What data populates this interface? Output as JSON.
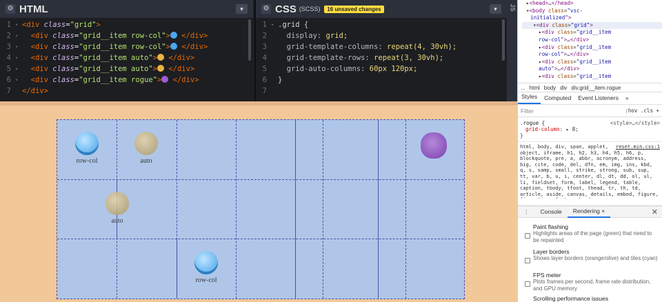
{
  "html_pane": {
    "title": "HTML",
    "lines": [
      {
        "num": "1",
        "fold": "▾",
        "parts": [
          {
            "c": "pl",
            "t": ""
          },
          {
            "c": "tg",
            "t": "<div "
          },
          {
            "c": "at",
            "t": "class"
          },
          {
            "c": "pl",
            "t": "="
          },
          {
            "c": "st",
            "t": "\"grid\""
          },
          {
            "c": "tg",
            "t": ">"
          }
        ]
      },
      {
        "num": "2",
        "fold": "▾",
        "parts": [
          {
            "c": "pl",
            "t": "  "
          },
          {
            "c": "tg",
            "t": "<div "
          },
          {
            "c": "at",
            "t": "class"
          },
          {
            "c": "pl",
            "t": "="
          },
          {
            "c": "st",
            "t": "\"grid__item row-col\""
          },
          {
            "c": "tg",
            "t": ">"
          },
          {
            "c": "em",
            "t": "cold"
          },
          {
            "c": "tg",
            "t": " </div>"
          }
        ]
      },
      {
        "num": "3",
        "fold": "▾",
        "parts": [
          {
            "c": "pl",
            "t": "  "
          },
          {
            "c": "tg",
            "t": "<div "
          },
          {
            "c": "at",
            "t": "class"
          },
          {
            "c": "pl",
            "t": "="
          },
          {
            "c": "st",
            "t": "\"grid__item row-col\""
          },
          {
            "c": "tg",
            "t": ">"
          },
          {
            "c": "em",
            "t": "cold"
          },
          {
            "c": "tg",
            "t": " </div>"
          }
        ]
      },
      {
        "num": "4",
        "fold": "▾",
        "parts": [
          {
            "c": "pl",
            "t": "  "
          },
          {
            "c": "tg",
            "t": "<div "
          },
          {
            "c": "at",
            "t": "class"
          },
          {
            "c": "pl",
            "t": "="
          },
          {
            "c": "st",
            "t": "\"grid__item auto\""
          },
          {
            "c": "tg",
            "t": ">"
          },
          {
            "c": "em",
            "t": "nerd"
          },
          {
            "c": "tg",
            "t": " </div>"
          }
        ]
      },
      {
        "num": "5",
        "fold": "▾",
        "parts": [
          {
            "c": "pl",
            "t": "  "
          },
          {
            "c": "tg",
            "t": "<div "
          },
          {
            "c": "at",
            "t": "class"
          },
          {
            "c": "pl",
            "t": "="
          },
          {
            "c": "st",
            "t": "\"grid__item auto\""
          },
          {
            "c": "tg",
            "t": ">"
          },
          {
            "c": "em",
            "t": "nerd"
          },
          {
            "c": "tg",
            "t": " </div>"
          }
        ]
      },
      {
        "num": "6",
        "fold": "▾",
        "parts": [
          {
            "c": "pl",
            "t": "  "
          },
          {
            "c": "tg",
            "t": "<div "
          },
          {
            "c": "at",
            "t": "class"
          },
          {
            "c": "pl",
            "t": "="
          },
          {
            "c": "st",
            "t": "\"grid__item rogue\""
          },
          {
            "c": "tg",
            "t": ">"
          },
          {
            "c": "em",
            "t": "devil"
          },
          {
            "c": "tg",
            "t": " </div>"
          }
        ]
      },
      {
        "num": "7",
        "fold": "",
        "parts": [
          {
            "c": "tg",
            "t": "</div>"
          }
        ]
      }
    ]
  },
  "css_pane": {
    "title": "CSS",
    "subtitle": "(SCSS)",
    "badge": "16 unsaved changes",
    "lines": [
      {
        "num": "1",
        "fold": "▾",
        "parts": [
          {
            "c": "sel",
            "t": ".grid {"
          }
        ]
      },
      {
        "num": "2",
        "fold": "",
        "parts": [
          {
            "c": "pr",
            "t": "  display: "
          },
          {
            "c": "vl",
            "t": "grid;"
          }
        ]
      },
      {
        "num": "3",
        "fold": "",
        "parts": [
          {
            "c": "pr",
            "t": "  grid-template-columns: "
          },
          {
            "c": "vl",
            "t": "repeat(4, 30vh);"
          }
        ]
      },
      {
        "num": "4",
        "fold": "",
        "parts": [
          {
            "c": "pr",
            "t": "  grid-template-rows: "
          },
          {
            "c": "vl",
            "t": "repeat(3, 30vh);"
          }
        ]
      },
      {
        "num": "5",
        "fold": "",
        "parts": [
          {
            "c": "pr",
            "t": "  grid-auto-columns: "
          },
          {
            "c": "vl",
            "t": "60px 120px;"
          }
        ]
      },
      {
        "num": "6",
        "fold": "",
        "parts": [
          {
            "c": "sel",
            "t": "}"
          }
        ]
      },
      {
        "num": "7",
        "fold": "",
        "parts": []
      }
    ]
  },
  "js_label": "JS",
  "preview": {
    "items": [
      {
        "label": "row-col",
        "face": "cold"
      },
      {
        "label": "auto",
        "face": "nerd"
      },
      {
        "label": "auto",
        "face": "nerd"
      },
      {
        "label": "row-col",
        "face": "cold"
      },
      {
        "label": "",
        "face": "devil"
      }
    ]
  },
  "devtools": {
    "dom_lines": [
      {
        "ind": 76,
        "html": "▸<span class='dtg'>&lt;head&gt;</span>…<span class='dtg'>&lt;/head&gt;</span>"
      },
      {
        "ind": 76,
        "html": "▾<span class='dtg'>&lt;body </span><span class='dat'>class</span>=<span class='dvl'>\"vsc-</span>"
      },
      {
        "ind": 82,
        "html": "<span class='dvl'>initialized\"</span><span class='dtg'>&gt;</span>"
      },
      {
        "ind": 86,
        "html": "▾<span class='dtg'>&lt;div </span><span class='dat'>class</span>=<span class='dvl'>\"grid\"</span><span class='dtg'>&gt;</span>",
        "hl": true
      },
      {
        "ind": 94,
        "html": "▸<span class='dtg'>&lt;div </span><span class='dat'>class</span>=<span class='dvl'>\"grid__item</span>"
      },
      {
        "ind": 94,
        "html": "<span class='dvl'>row-col\"</span><span class='dtg'>&gt;</span>…<span class='dtg'>&lt;/div&gt;</span>"
      },
      {
        "ind": 94,
        "html": "▸<span class='dtg'>&lt;div </span><span class='dat'>class</span>=<span class='dvl'>\"grid__item</span>"
      },
      {
        "ind": 94,
        "html": "<span class='dvl'>row-col\"</span><span class='dtg'>&gt;</span>…<span class='dtg'>&lt;/div&gt;</span>"
      },
      {
        "ind": 94,
        "html": "▸<span class='dtg'>&lt;div </span><span class='dat'>class</span>=<span class='dvl'>\"grid__item</span>"
      },
      {
        "ind": 94,
        "html": "<span class='dvl'>auto\"</span><span class='dtg'>&gt;</span>…<span class='dtg'>&lt;/div&gt;</span>"
      },
      {
        "ind": 94,
        "html": "▸<span class='dtg'>&lt;div </span><span class='dat'>class</span>=<span class='dvl'>\"grid__item</span>"
      }
    ],
    "breadcrumbs": [
      "...",
      "html",
      "body",
      "div",
      "div.grid__item.rogue"
    ],
    "tabs": [
      "Styles",
      "Computed",
      "Event Listeners",
      "»"
    ],
    "filter_placeholder": "Filter",
    "filter_right": ":hov  .cls  +",
    "rule_selector": ".rogue {",
    "rule_source": "<style>…</style>",
    "rule_prop": "grid-column:",
    "rule_value": "▸ 8;",
    "rule_close": "}",
    "ua_source": "reset.min.css:1",
    "ua_text": "html, body, div, span, applet, object, iframe, h1, h2, h3, h4, h5, h6, p, blockquote, pre, a, abbr, acronym, address, big, cite, code, del, dfn, em, img, ins, kbd, q, s, samp, small, strike, strong, sub, sup, tt, var, b, u, i, center, dl, dt, dd, ol, ul, li, fieldset, form, label, legend, table, caption, tbody, tfoot, thead, tr, th, td, article, aside, canvas, details, embed, figure, figcaption, footer, header,",
    "drawer_tabs": [
      "Console",
      "Rendering ×"
    ],
    "options": [
      {
        "title": "Paint flashing",
        "desc": "Highlights areas of the page (green) that need to be repainted"
      },
      {
        "title": "Layer borders",
        "desc": "Shows layer borders (orange/olive) and tiles (cyan)"
      },
      {
        "title": "FPS meter",
        "desc": "Plots frames per second, frame rate distribution, and GPU memory"
      },
      {
        "title": "Scrolling performance issues",
        "desc": ""
      }
    ]
  }
}
